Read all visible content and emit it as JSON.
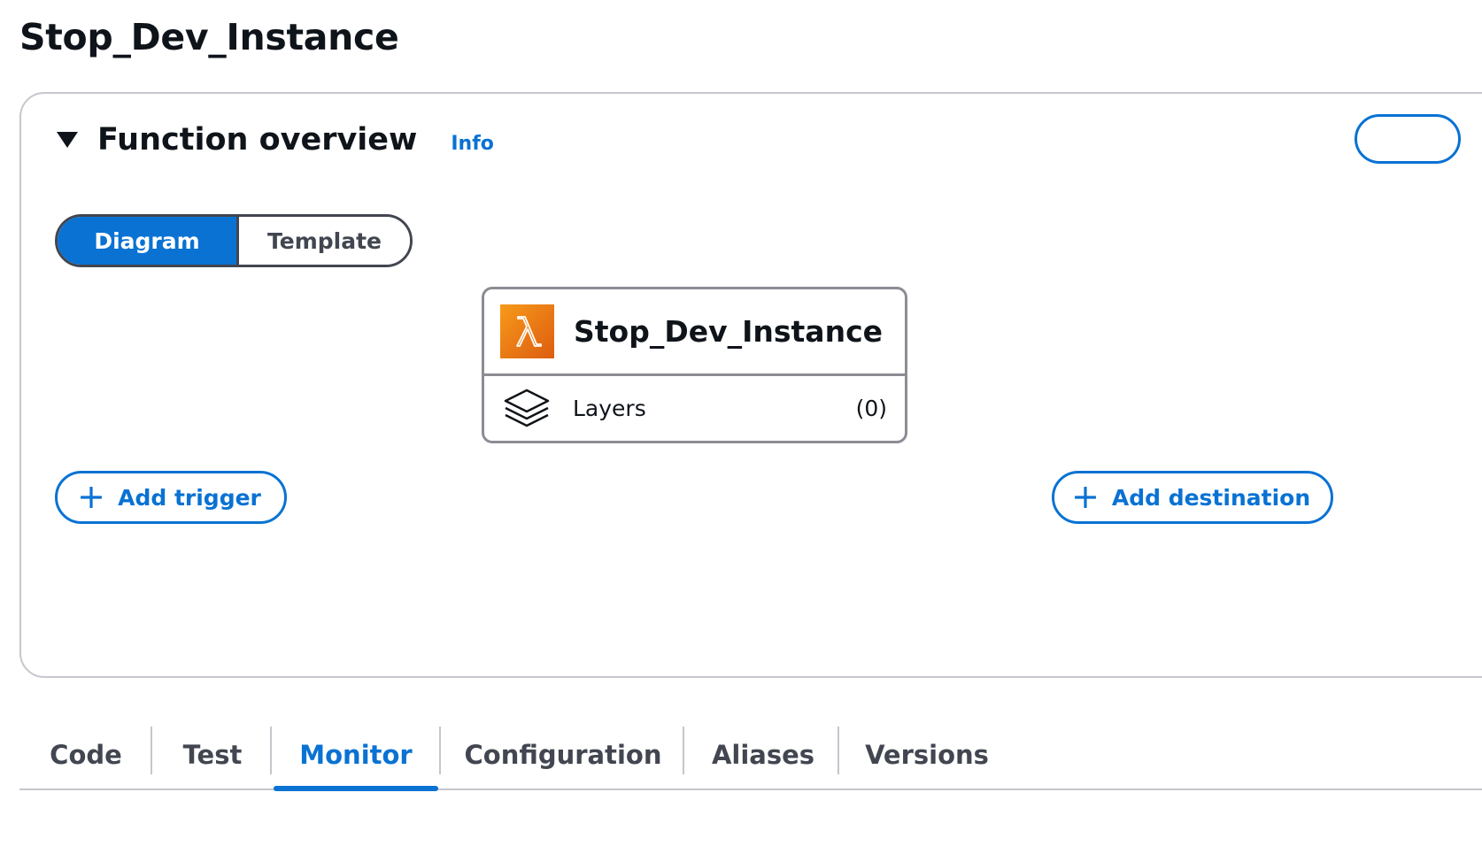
{
  "page": {
    "title": "Stop_Dev_Instance"
  },
  "overview": {
    "title": "Function overview",
    "info_label": "Info",
    "view_toggle": {
      "options": [
        "Diagram",
        "Template"
      ],
      "selected": "Diagram"
    },
    "function_card": {
      "name": "Stop_Dev_Instance",
      "icon": "lambda-icon",
      "layers_label": "Layers",
      "layers_count": "(0)"
    },
    "add_trigger_label": "Add trigger",
    "add_destination_label": "Add destination"
  },
  "tabs": {
    "items": [
      "Code",
      "Test",
      "Monitor",
      "Configuration",
      "Aliases",
      "Versions"
    ],
    "active": "Monitor"
  },
  "colors": {
    "accent": "#0972d3",
    "lambda_orange": "#ed7100"
  }
}
